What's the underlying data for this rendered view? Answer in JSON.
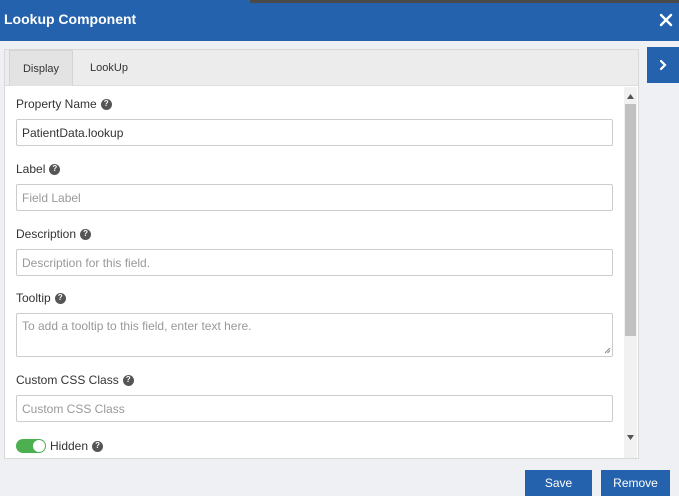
{
  "header": {
    "title": "Lookup Component"
  },
  "tabs": [
    {
      "label": "Display"
    },
    {
      "label": "LookUp"
    }
  ],
  "fields": {
    "property_name": {
      "label": "Property Name",
      "value": "PatientData.lookup"
    },
    "label": {
      "label": "Label",
      "placeholder": "Field Label"
    },
    "description": {
      "label": "Description",
      "placeholder": "Description for this field."
    },
    "tooltip": {
      "label": "Tooltip",
      "placeholder": "To add a tooltip to this field, enter text here."
    },
    "custom_css": {
      "label": "Custom CSS Class",
      "placeholder": "Custom CSS Class"
    },
    "hidden": {
      "label": "Hidden",
      "checked": true
    }
  },
  "buttons": {
    "save": "Save",
    "remove": "Remove"
  },
  "icons": {
    "close": "close-icon",
    "sidebar": "chevron-right-icon",
    "help": "question-circle-icon"
  },
  "colors": {
    "primary": "#2462ad",
    "toggle_on": "#4caf50"
  }
}
